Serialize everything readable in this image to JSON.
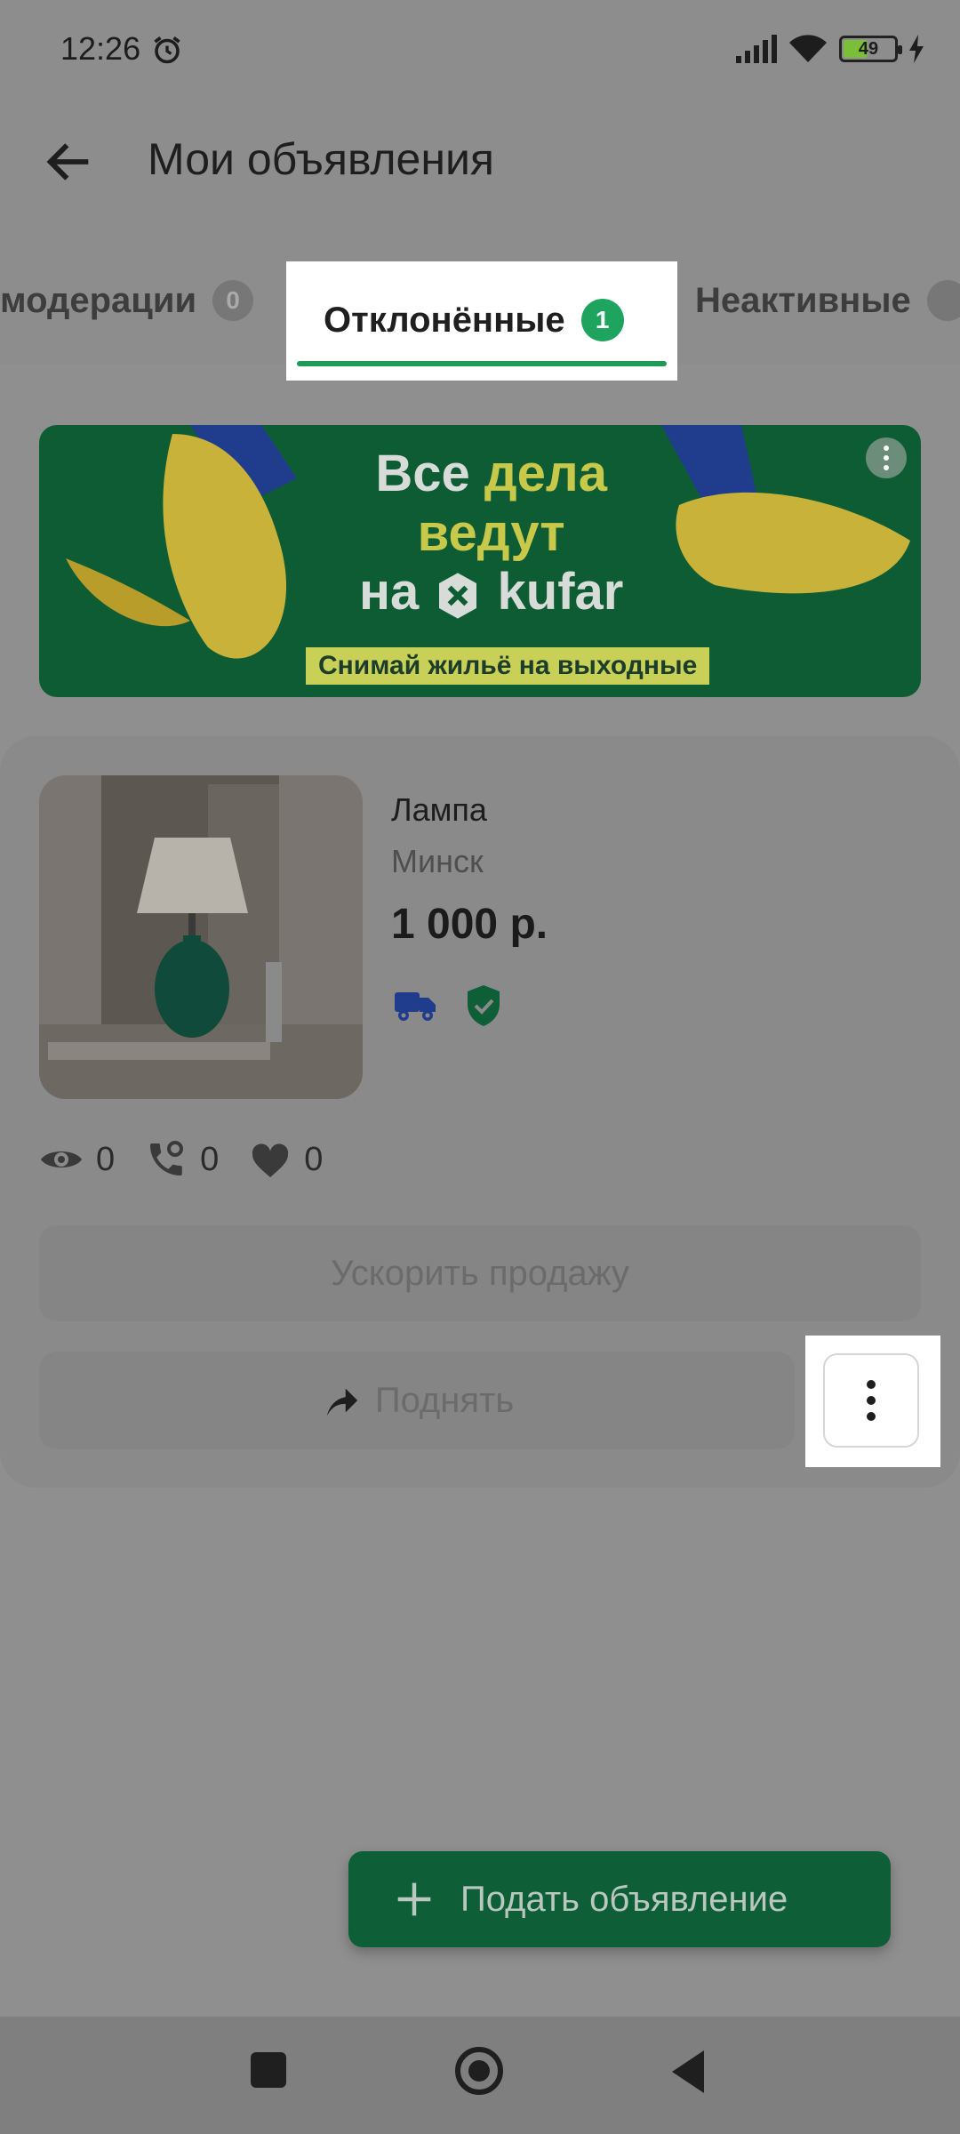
{
  "status_bar": {
    "time": "12:26",
    "battery": "49",
    "battery_level": 0.49
  },
  "app_bar": {
    "title": "Мои объявления"
  },
  "tabs": [
    {
      "label": "модерации",
      "count": "0",
      "active": false
    },
    {
      "label": "Отклонённые",
      "count": "1",
      "active": true
    },
    {
      "label": "Неактивные",
      "count": "",
      "active": false
    }
  ],
  "banner": {
    "line1": "Все",
    "line1_accent": "дела",
    "line2": "ведут",
    "line3_prefix": "на",
    "brand": "kufar",
    "subtitle": "Снимай жильё на выходные"
  },
  "listing": {
    "title": "Лампа",
    "city": "Минск",
    "price": "1 000 р.",
    "views": "0",
    "calls": "0",
    "favorites": "0"
  },
  "buttons": {
    "boost": "Ускорить продажу",
    "raise": "Поднять",
    "fab": "Подать объявление"
  },
  "colors": {
    "accent": "#1fa45f",
    "fab": "#0e5f38"
  }
}
